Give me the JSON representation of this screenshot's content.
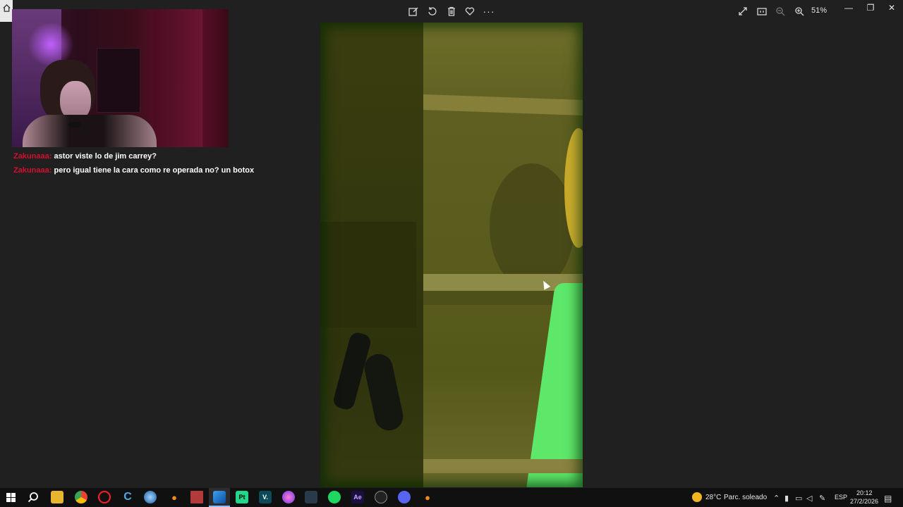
{
  "viewer": {
    "zoom_label": "51%"
  },
  "toolbar_icons": [
    "edit-icon",
    "rotate-icon",
    "trash-icon",
    "heart-icon",
    "more-icon"
  ],
  "chat": {
    "messages": [
      {
        "user": "Zakunaaa:",
        "text": "astor viste lo de jim carrey?"
      },
      {
        "user": "Zakunaaa:",
        "text": "pero igual tiene la cara como re operada no? un botox"
      }
    ]
  },
  "taskbar": {
    "weather_temp": "28°C",
    "weather_desc": "Parc. soleado",
    "language": "ESP",
    "time": "20:12",
    "date": "27/2/2026",
    "apps": [
      {
        "name": "search-icon",
        "label": ""
      },
      {
        "name": "file-explorer-icon",
        "label": ""
      },
      {
        "name": "chrome-icon",
        "label": ""
      },
      {
        "name": "opera-icon",
        "label": "O"
      },
      {
        "name": "ccleaner-icon",
        "label": "C"
      },
      {
        "name": "app-icon",
        "label": ""
      },
      {
        "name": "blender-icon",
        "label": ""
      },
      {
        "name": "video-editor-icon",
        "label": ""
      },
      {
        "name": "photos-icon",
        "label": ""
      },
      {
        "name": "pycharm-icon",
        "label": "Pt"
      },
      {
        "name": "vegas-icon",
        "label": "V."
      },
      {
        "name": "app2-icon",
        "label": ""
      },
      {
        "name": "davinci-icon",
        "label": ""
      },
      {
        "name": "spotify-icon",
        "label": ""
      },
      {
        "name": "after-effects-icon",
        "label": "Ae"
      },
      {
        "name": "obs-icon",
        "label": ""
      },
      {
        "name": "discord-icon",
        "label": ""
      },
      {
        "name": "blender2-icon",
        "label": ""
      }
    ]
  },
  "colors": {
    "chat_user": "#d40f2e",
    "background": "#202020",
    "taskbar": "#101010"
  }
}
